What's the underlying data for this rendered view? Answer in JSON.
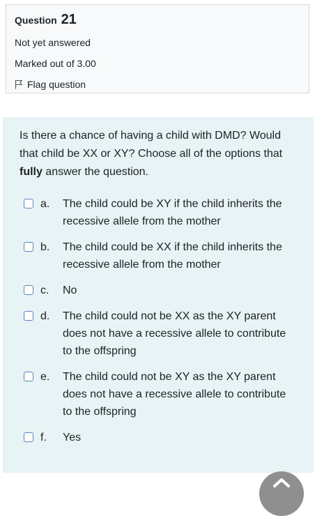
{
  "info": {
    "question_label": "Question",
    "question_number": "21",
    "state": "Not yet answered",
    "grade": "Marked out of 3.00",
    "flag_label": "Flag question"
  },
  "question": {
    "text_before": "Is there a chance of having a child with DMD? Would that child be XX or XY? Choose all of the options that ",
    "text_bold": "fully",
    "text_after": " answer the question."
  },
  "options": [
    {
      "letter": "a.",
      "text": "The child could be XY if the child inherits the recessive allele from the mother",
      "checked": false
    },
    {
      "letter": "b.",
      "text": "The child could be XX if the child inherits the recessive allele from the mother",
      "checked": false
    },
    {
      "letter": "c.",
      "text": "No",
      "checked": false
    },
    {
      "letter": "d.",
      "text": "The child could not be XX as the XY parent does not have a recessive allele to contribute to the offspring",
      "checked": false
    },
    {
      "letter": "e.",
      "text": "The child could not be XY as the XY parent does not have a recessive allele to contribute to the offspring",
      "checked": false
    },
    {
      "letter": "f.",
      "text": "Yes",
      "checked": false
    }
  ],
  "icons": {
    "flag": "flag-icon",
    "checkbox": "checkbox-icon",
    "back_to_top": "chevron-up-icon"
  },
  "colors": {
    "formulation_bg": "#e7f3f5",
    "info_bg": "#f8f9fa",
    "checkbox_border": "#5b86b8"
  }
}
